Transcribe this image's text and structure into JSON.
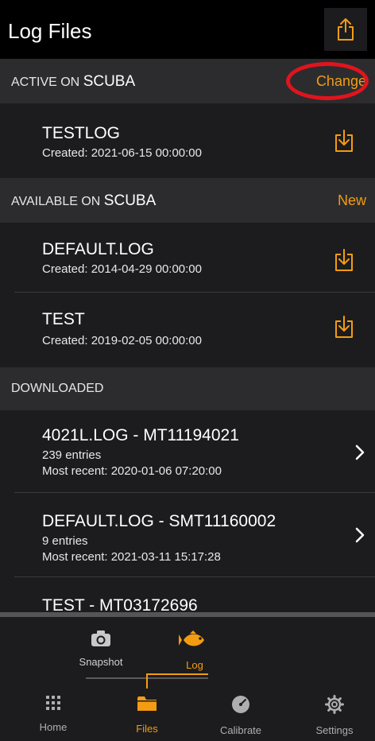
{
  "header": {
    "title": "Log Files"
  },
  "sections": {
    "active": {
      "label": "ACTIVE ON ",
      "device": "SCUBA",
      "action": "Change"
    },
    "available": {
      "label": "AVAILABLE ON ",
      "device": "SCUBA",
      "action": "New"
    },
    "downloaded": {
      "label": "DOWNLOADED"
    }
  },
  "active_log": {
    "name": "TESTLOG",
    "created": "Created: 2021-06-15 00:00:00"
  },
  "available_logs": [
    {
      "name": "DEFAULT.LOG",
      "created": "Created: 2014-04-29 00:00:00"
    },
    {
      "name": "TEST",
      "created": "Created: 2019-02-05 00:00:00"
    }
  ],
  "downloaded_logs": [
    {
      "name": "4021L.LOG - MT11194021",
      "entries": "239 entries",
      "recent": "Most recent: 2020-01-06 07:20:00"
    },
    {
      "name": "DEFAULT.LOG - SMT11160002",
      "entries": "9 entries",
      "recent": "Most recent: 2021-03-11 15:17:28"
    },
    {
      "name": "TEST - MT03172696"
    }
  ],
  "modes": {
    "snapshot": "Snapshot",
    "log": "Log"
  },
  "tabs": {
    "home": "Home",
    "files": "Files",
    "calibrate": "Calibrate",
    "settings": "Settings"
  },
  "colors": {
    "accent": "#f39c12",
    "highlight": "#e0141e",
    "background": "#1c1c1e",
    "section": "#2c2c2e"
  },
  "icons": [
    "share-icon",
    "download-icon",
    "chevron-right-icon",
    "camera-icon",
    "fish-icon",
    "grid-icon",
    "folder-icon",
    "gauge-icon",
    "gear-icon"
  ]
}
